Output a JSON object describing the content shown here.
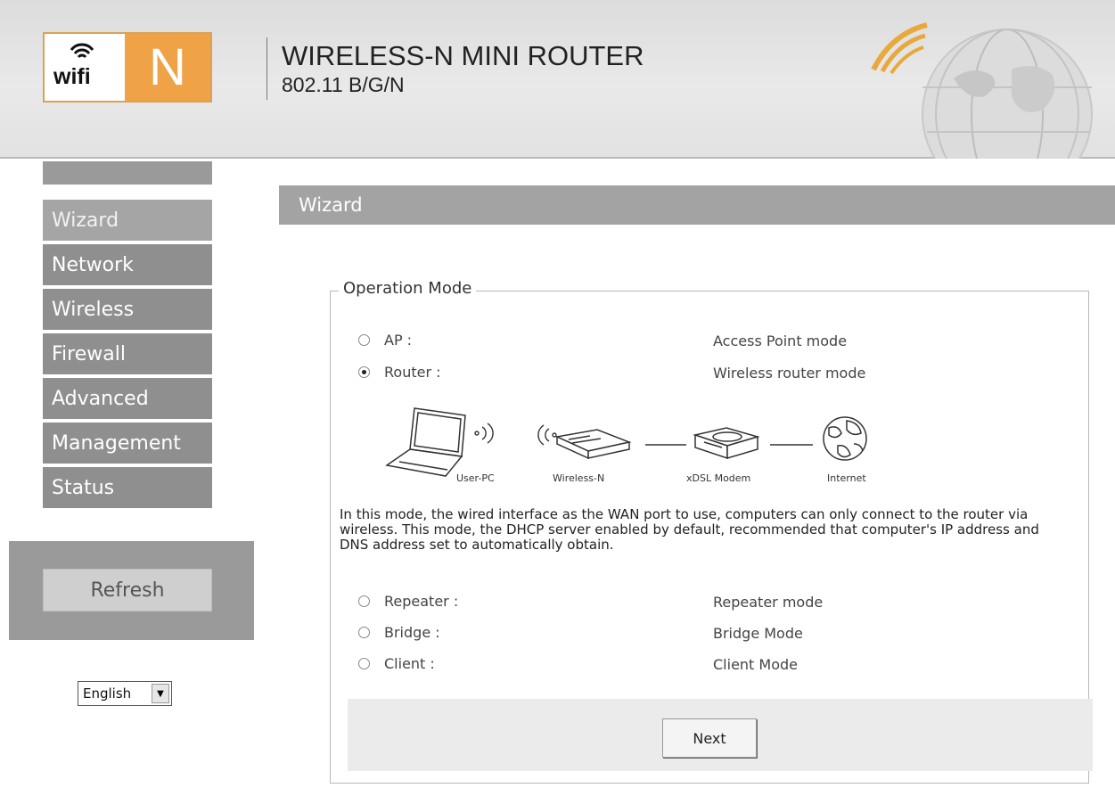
{
  "header": {
    "logo_wifi": "wifi",
    "logo_letter": "N",
    "title": "WIRELESS-N MINI ROUTER",
    "subtitle": "802.11 B/G/N"
  },
  "sidebar": {
    "items": [
      {
        "label": "Wizard",
        "active": true
      },
      {
        "label": "Network",
        "active": false
      },
      {
        "label": "Wireless",
        "active": false
      },
      {
        "label": "Firewall",
        "active": false
      },
      {
        "label": "Advanced",
        "active": false
      },
      {
        "label": "Management",
        "active": false
      },
      {
        "label": "Status",
        "active": false
      }
    ],
    "refresh_label": "Refresh",
    "language": {
      "selected": "English"
    }
  },
  "main": {
    "page_title": "Wizard",
    "fieldset_legend": "Operation Mode",
    "modes": [
      {
        "label": "AP :",
        "description": "Access Point mode",
        "selected": false
      },
      {
        "label": "Router :",
        "description": "Wireless router mode",
        "selected": true
      },
      {
        "label": "Repeater :",
        "description": "Repeater mode",
        "selected": false
      },
      {
        "label": "Bridge :",
        "description": "Bridge Mode",
        "selected": false
      },
      {
        "label": "Client :",
        "description": "Client Mode",
        "selected": false
      }
    ],
    "diagram_labels": [
      "User-PC",
      "Wireless-N",
      "xDSL Modem",
      "Internet"
    ],
    "mode_description": "In this mode, the wired interface as the WAN port to use, computers can only connect to the router via wireless. This mode, the DHCP server enabled by default, recommended that computer's IP address and DNS address set to automatically obtain.",
    "next_label": "Next"
  },
  "colors": {
    "logo_orange": "#f0a346",
    "nav_gray": "#8f8f8f",
    "title_bar_gray": "#a3a3a3"
  }
}
